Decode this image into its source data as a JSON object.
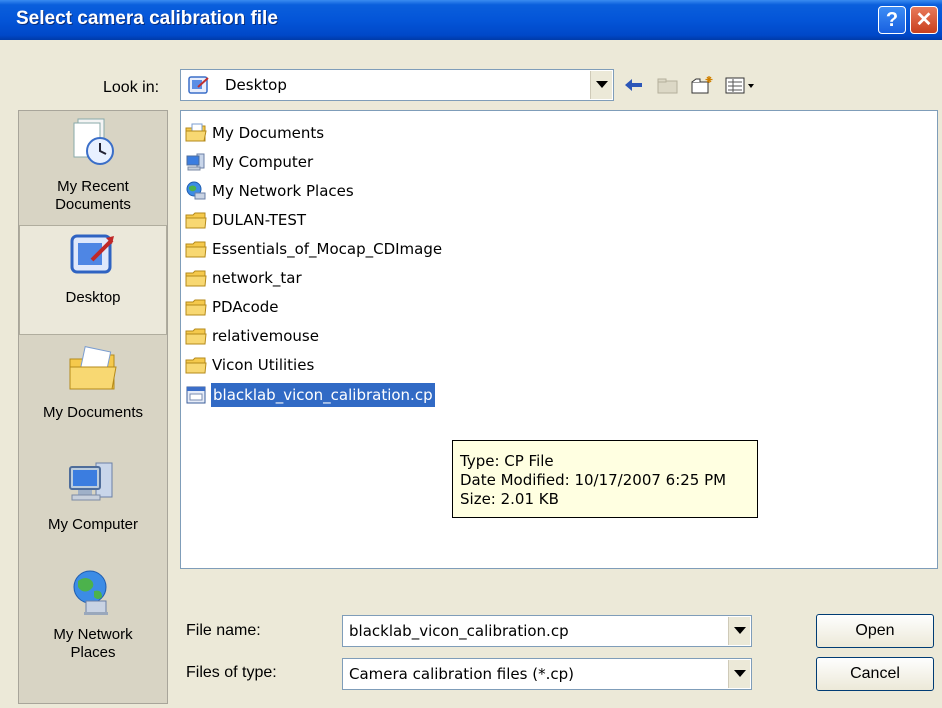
{
  "window": {
    "title": "Select camera calibration file",
    "help_glyph": "?",
    "close_glyph": "✕"
  },
  "lookin": {
    "label": "Look in:",
    "value": "Desktop",
    "icon": "desktop-icon"
  },
  "toolbar": {
    "icons": [
      "back-arrow-icon",
      "up-folder-icon",
      "new-folder-icon",
      "view-menu-icon"
    ]
  },
  "places": [
    {
      "label": "My Recent Documents",
      "line1": "My Recent",
      "line2": "Documents",
      "icon": "recent-documents-icon"
    },
    {
      "label": "Desktop",
      "line1": "Desktop",
      "line2": "",
      "icon": "desktop-icon",
      "active": true
    },
    {
      "label": "My Documents",
      "line1": "My Documents",
      "line2": "",
      "icon": "my-documents-icon"
    },
    {
      "label": "My Computer",
      "line1": "My Computer",
      "line2": "",
      "icon": "my-computer-icon"
    },
    {
      "label": "My Network Places",
      "line1": "My Network",
      "line2": "Places",
      "icon": "network-places-icon"
    }
  ],
  "files": [
    {
      "name": "My Documents",
      "type": "special-docs"
    },
    {
      "name": "My Computer",
      "type": "special-computer"
    },
    {
      "name": "My Network Places",
      "type": "special-network"
    },
    {
      "name": "DULAN-TEST",
      "type": "folder"
    },
    {
      "name": "Essentials_of_Mocap_CDImage",
      "type": "folder"
    },
    {
      "name": "network_tar",
      "type": "folder"
    },
    {
      "name": "PDAcode",
      "type": "folder"
    },
    {
      "name": "relativemouse",
      "type": "folder"
    },
    {
      "name": "Vicon Utilities",
      "type": "folder"
    },
    {
      "name": "blacklab_vicon_calibration.cp",
      "type": "file",
      "selected": true
    }
  ],
  "tooltip": {
    "type": "Type: CP File",
    "modified": "Date Modified: 10/17/2007 6:25 PM",
    "size": "Size: 2.01 KB"
  },
  "filename": {
    "label": "File name:",
    "value": "blacklab_vicon_calibration.cp"
  },
  "filetype": {
    "label": "Files of type:",
    "value": "Camera calibration files (*.cp)"
  },
  "buttons": {
    "open": "Open",
    "cancel": "Cancel"
  }
}
